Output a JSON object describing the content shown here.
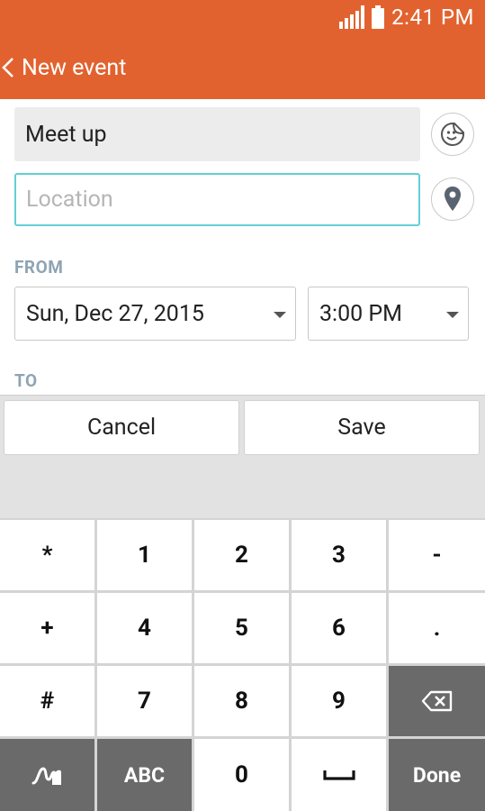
{
  "status": {
    "time": "2:41 PM"
  },
  "header": {
    "title": "New event"
  },
  "form": {
    "title_value": "Meet up",
    "location_placeholder": "Location",
    "from_label": "FROM",
    "from_date": "Sun, Dec 27, 2015",
    "from_time": "3:00 PM",
    "to_label": "TO"
  },
  "actions": {
    "cancel_label": "Cancel",
    "save_label": "Save"
  },
  "keyboard": {
    "row1": [
      "*",
      "1",
      "2",
      "3",
      "-"
    ],
    "row2": [
      "+",
      "4",
      "5",
      "6",
      "."
    ],
    "row3": [
      "#",
      "7",
      "8",
      "9"
    ],
    "abc_label": "ABC",
    "zero_label": "0",
    "done_label": "Done"
  },
  "icons": {
    "back": "chevron-left-icon",
    "sticker": "sticker-smiley-icon",
    "location": "map-pin-icon",
    "backspace": "backspace-icon",
    "handwriting": "handwriting-icon",
    "space": "space-bar-icon"
  },
  "colors": {
    "accent": "#e2622f",
    "focus_border": "#63cfd6",
    "section_label": "#8ea4b3",
    "dark_key": "#6a6a6a"
  }
}
